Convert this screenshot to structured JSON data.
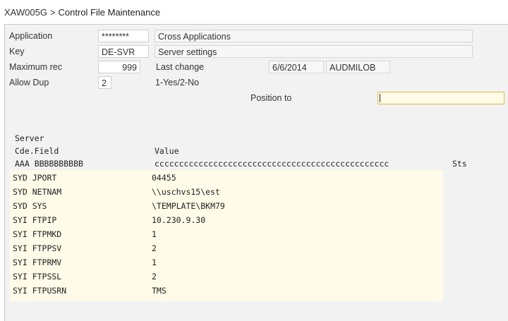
{
  "breadcrumb": {
    "program": "XAW005G",
    "separator": ">",
    "title": "Control File Maintenance"
  },
  "form": {
    "application_label": "Application",
    "application_code": "********",
    "application_desc": "Cross Applications",
    "key_label": "Key",
    "key_code": "DE-SVR",
    "key_desc": "Server settings",
    "max_rec_label": "Maximum rec",
    "max_rec_value": "999",
    "last_change_label": "Last change",
    "last_change_date": "6/6/2014",
    "last_change_user": "AUDMILOB",
    "allow_dup_label": "Allow Dup",
    "allow_dup_value": "2",
    "allow_dup_hint": "1-Yes/2-No",
    "position_label": "Position to",
    "position_value": ""
  },
  "grid": {
    "header_line1": "Server",
    "header_code": "Cde.Field",
    "header_value": "Value",
    "mask_code": "AAA BBBBBBBBBB",
    "mask_value": "cccccccccccccccccccccccccccccccccccccccccccccccc",
    "header_sts": "Sts",
    "rows": [
      {
        "code": "SYD JPORT",
        "value": "04455"
      },
      {
        "code": "SYD NETNAM",
        "value": "\\\\uschvs15\\est"
      },
      {
        "code": "SYD SYS",
        "value": "\\TEMPLATE\\BKM79"
      },
      {
        "code": "SYI FTPIP",
        "value": "10.230.9.30"
      },
      {
        "code": "SYI FTPMKD",
        "value": "1"
      },
      {
        "code": "SYI FTPPSV",
        "value": "2"
      },
      {
        "code": "SYI FTPRMV",
        "value": "1"
      },
      {
        "code": "SYI FTPSSL",
        "value": "2"
      },
      {
        "code": "SYI FTPUSRN",
        "value": "TMS"
      }
    ]
  }
}
